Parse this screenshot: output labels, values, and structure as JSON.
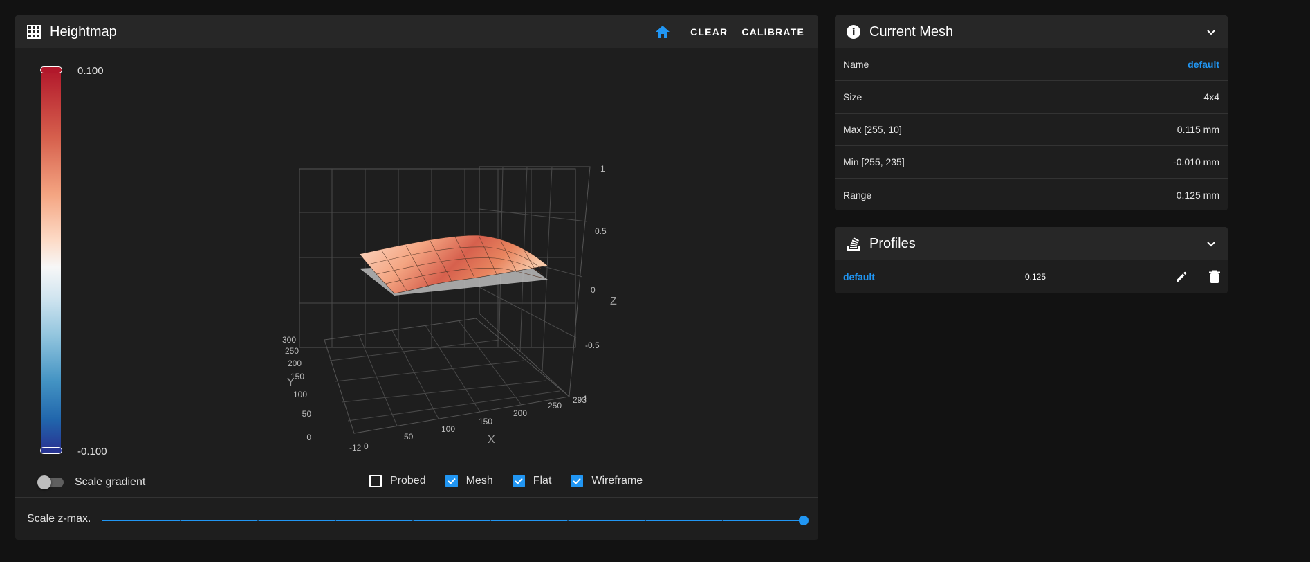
{
  "heightmap": {
    "title": "Heightmap",
    "clear_label": "CLEAR",
    "calibrate_label": "CALIBRATE",
    "gradient_max": "0.100",
    "gradient_min": "-0.100",
    "scale_gradient_label": "Scale gradient",
    "scale_gradient_on": false,
    "checkboxes": [
      {
        "label": "Probed",
        "checked": false
      },
      {
        "label": "Mesh",
        "checked": true
      },
      {
        "label": "Flat",
        "checked": true
      },
      {
        "label": "Wireframe",
        "checked": true
      }
    ],
    "scale_zmax_label": "Scale z-max.",
    "scale_zmax_value": 1.0,
    "plot": {
      "x_title": "X",
      "y_title": "Y",
      "z_title": "Z",
      "x_ticks": [
        "-12",
        "0",
        "50",
        "100",
        "150",
        "200",
        "250",
        "293"
      ],
      "y_ticks": [
        "0",
        "50",
        "100",
        "150",
        "200",
        "250",
        "300"
      ],
      "z_ticks": [
        "1",
        "0.5",
        "0",
        "-0.5",
        "-1"
      ]
    }
  },
  "current_mesh": {
    "title": "Current Mesh",
    "rows": [
      {
        "label": "Name",
        "value": "default"
      },
      {
        "label": "Size",
        "value": "4x4"
      },
      {
        "label": "Max [255, 10]",
        "value": "0.115 mm"
      },
      {
        "label": "Min [255, 235]",
        "value": "-0.010 mm"
      },
      {
        "label": "Range",
        "value": "0.125 mm"
      }
    ]
  },
  "profiles": {
    "title": "Profiles",
    "items": [
      {
        "name": "default",
        "range": "0.125"
      }
    ]
  },
  "colors": {
    "accent": "#2196f3",
    "card": "#1e1e1e",
    "header": "#272727"
  }
}
